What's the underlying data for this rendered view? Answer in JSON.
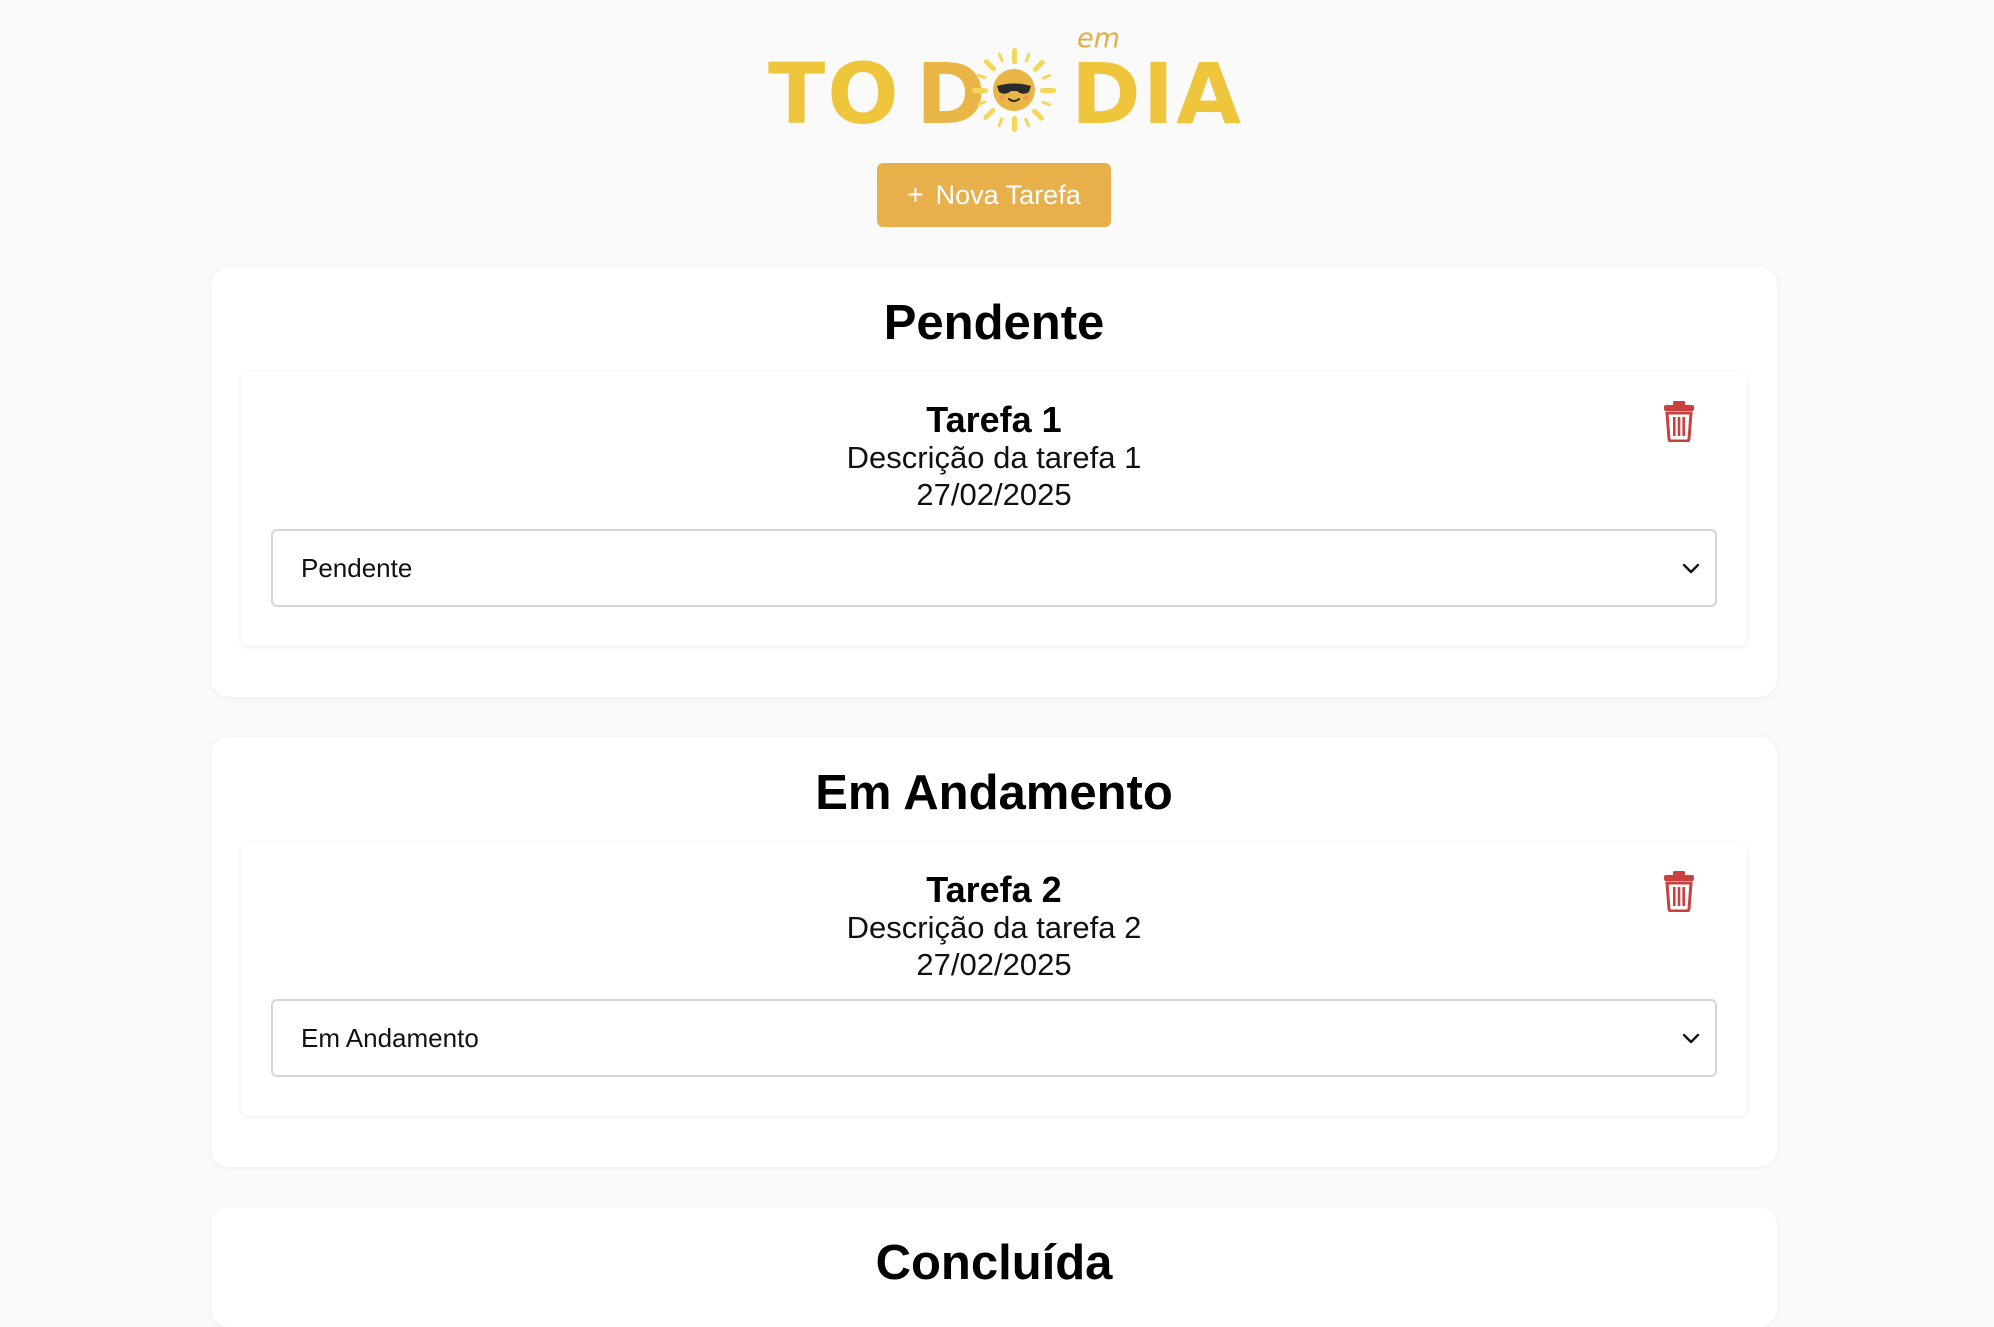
{
  "logo": {
    "part1": "TO",
    "part2": "D",
    "part3": "DIA",
    "small": "em",
    "icon": "sun-with-sunglasses-icon",
    "colors": {
      "yellow": "#efc63b",
      "orange": "#e9b546",
      "sun": "#f3d75a"
    }
  },
  "toolbar": {
    "new_task_icon": "+",
    "new_task_label": "Nova Tarefa",
    "accent": "#e8b04a"
  },
  "columns": [
    {
      "title": "Pendente",
      "tasks": [
        {
          "title": "Tarefa 1",
          "description": "Descrição da tarefa 1",
          "date": "27/02/2025",
          "status": "Pendente"
        }
      ]
    },
    {
      "title": "Em Andamento",
      "tasks": [
        {
          "title": "Tarefa 2",
          "description": "Descrição da tarefa 2",
          "date": "27/02/2025",
          "status": "Em Andamento"
        }
      ]
    },
    {
      "title": "Concluída",
      "tasks": []
    }
  ],
  "icons": {
    "delete": "trash-icon",
    "delete_color": "#c9403f",
    "select": "chevron-down-icon"
  }
}
